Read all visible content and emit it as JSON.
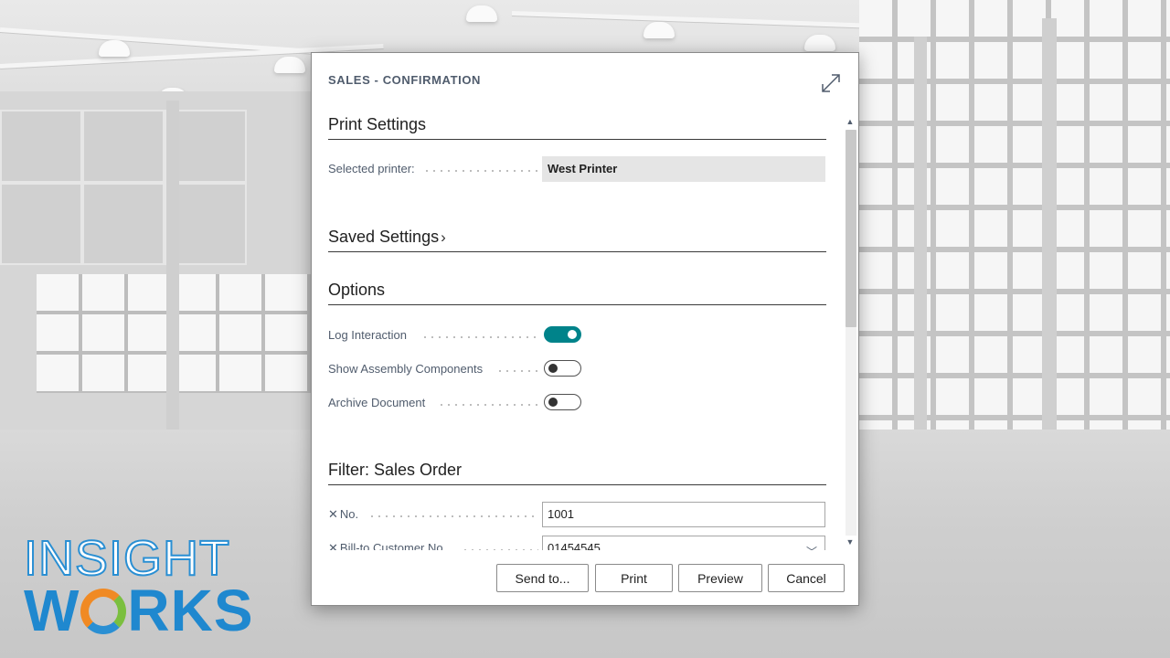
{
  "dialog": {
    "title": "SALES - CONFIRMATION"
  },
  "sections": {
    "print_settings": "Print Settings",
    "saved_settings": "Saved Settings",
    "options": "Options",
    "filter": "Filter: Sales Order"
  },
  "print_settings": {
    "selected_printer_label": "Selected printer:",
    "selected_printer_value": "West Printer"
  },
  "options": {
    "log_interaction": {
      "label": "Log Interaction",
      "on": true
    },
    "show_assembly_components": {
      "label": "Show Assembly Components",
      "on": false
    },
    "archive_document": {
      "label": "Archive Document",
      "on": false
    }
  },
  "filter": {
    "no_label": "No.",
    "no_value": "1001",
    "bill_to_label": "Bill-to Customer No.",
    "bill_to_value": "01454545"
  },
  "buttons": {
    "send_to": "Send to...",
    "print": "Print",
    "preview": "Preview",
    "cancel": "Cancel"
  },
  "logo": {
    "line1": "INSIGHT",
    "line2_pre": "W",
    "line2_post": "RKS"
  },
  "colors": {
    "accent": "#00838a",
    "logo_blue": "#1f88cf",
    "logo_orange": "#f08a24",
    "logo_green": "#7bbf3f"
  }
}
